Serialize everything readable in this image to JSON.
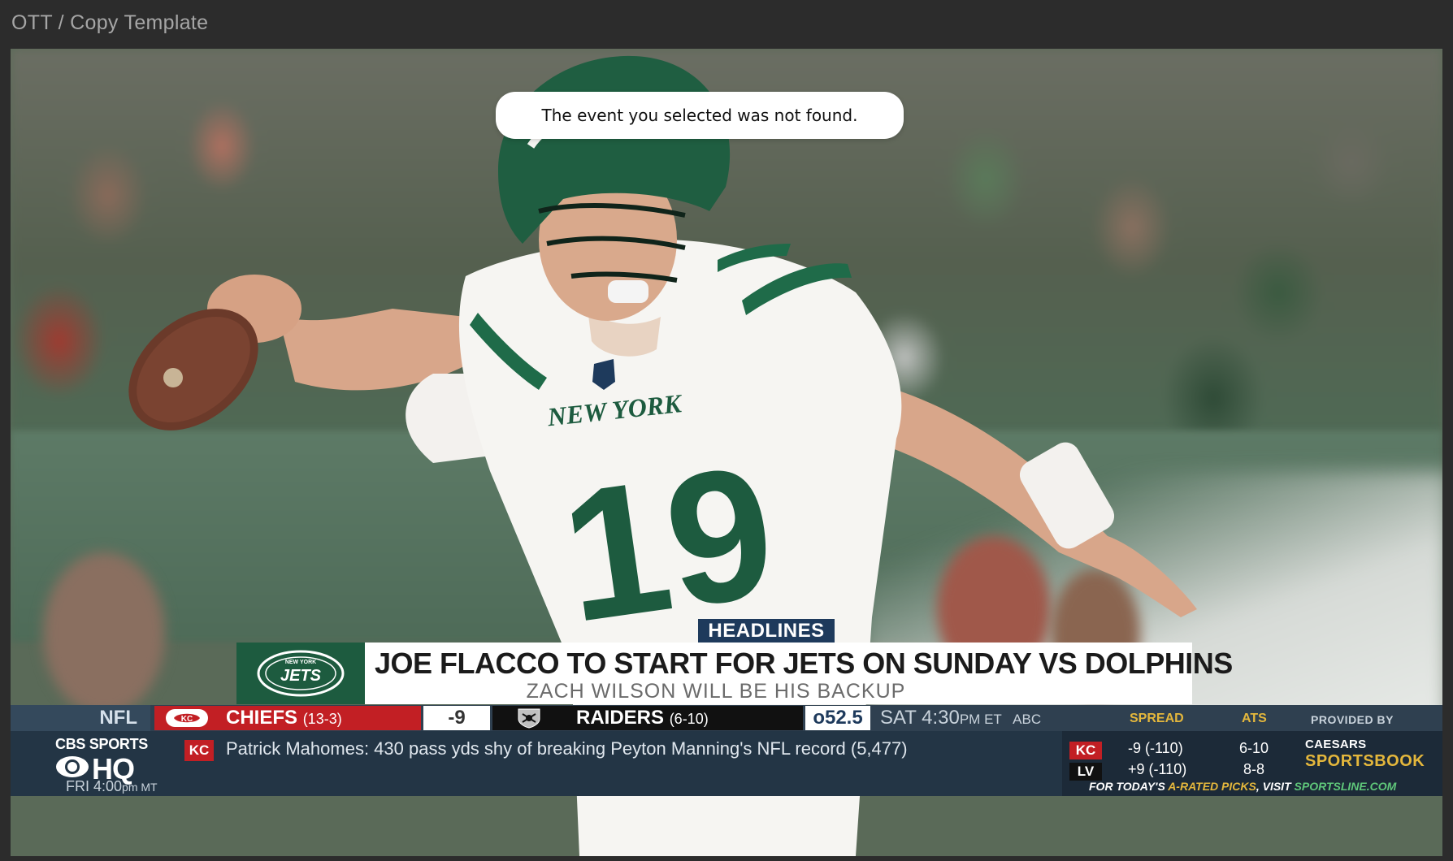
{
  "window": {
    "breadcrumb": "OTT / Copy Template"
  },
  "toast": {
    "message": "The event you selected was not found."
  },
  "jersey": {
    "wordmark": "NEW YORK",
    "number": "19"
  },
  "headline": {
    "tag": "HEADLINES",
    "logo_text": "JETS",
    "logo_top_text": "NEW YORK",
    "title": "JOE FLACCO TO START FOR JETS ON SUNDAY VS DOLPHINS",
    "subtitle": "ZACH WILSON WILL BE HIS BACKUP"
  },
  "scoreboard": {
    "league": "NFL",
    "home": {
      "name": "CHIEFS",
      "record": "(13-3)",
      "color": "#c21f24"
    },
    "line": "-9",
    "away": {
      "name": "RAIDERS",
      "record": "(6-10)"
    },
    "over_under": "o52.5",
    "time": "SAT 4:30",
    "time_suffix": "PM ET",
    "network": "ABC"
  },
  "brand": {
    "top": "CBS SPORTS",
    "hq": "HQ",
    "local_time": "FRI 4:00",
    "local_tz": "pm MT"
  },
  "ticker": {
    "team_badge": "KC",
    "text": "Patrick Mahomes: 430 pass yds shy of breaking Peyton Manning's NFL record (5,477)"
  },
  "odds": {
    "headers": {
      "spread": "SPREAD",
      "ats": "ATS",
      "provided_by": "PROVIDED BY"
    },
    "rows": [
      {
        "team": "KC",
        "spread": "-9 (-110)",
        "ats": "6-10"
      },
      {
        "team": "LV",
        "spread": "+9 (-110)",
        "ats": "8-8"
      }
    ],
    "sponsor_top": "CAESARS",
    "sponsor_bottom": "SPORTSBOOK",
    "footer_a": "FOR TODAY'S ",
    "footer_b": "A-RATED PICKS",
    "footer_c": ", VISIT ",
    "footer_d": "SPORTSLINE.COM"
  },
  "colors": {
    "accent_gold": "#e4b73c",
    "jets_green": "#1d5b3f",
    "navy": "#1e3a5c"
  }
}
